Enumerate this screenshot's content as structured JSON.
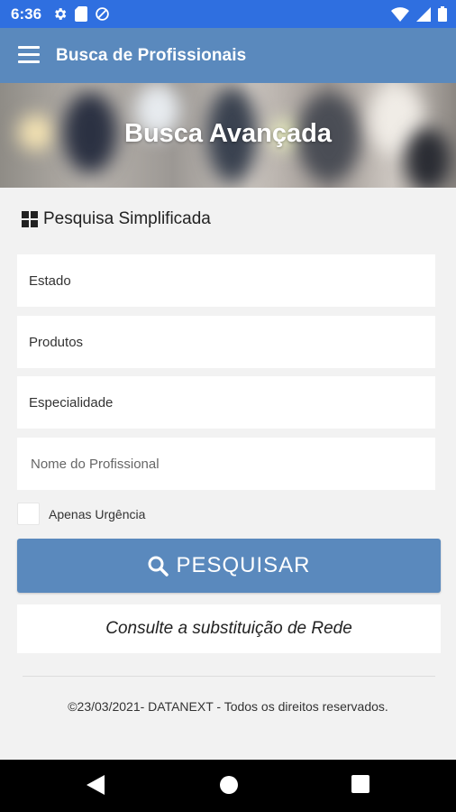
{
  "status_bar": {
    "time": "6:36",
    "left_icons": [
      "gear-icon",
      "sd-card-icon",
      "data-saver-icon"
    ],
    "right_icons": [
      "wifi-icon",
      "signal-icon",
      "battery-icon"
    ]
  },
  "app_bar": {
    "title": "Busca de Profissionais",
    "menu_icon": "menu-icon"
  },
  "hero": {
    "title": "Busca Avançada"
  },
  "section": {
    "title": "Pesquisa Simplificada",
    "icon": "grid-icon"
  },
  "form": {
    "estado": {
      "value": "Estado"
    },
    "produtos": {
      "value": "Produtos"
    },
    "especialidade": {
      "value": "Especialidade"
    },
    "nome": {
      "placeholder": "Nome do Profissional"
    },
    "urgencia": {
      "label": "Apenas Urgência",
      "checked": false
    }
  },
  "actions": {
    "search_label": "PESQUISAR",
    "search_icon": "search-icon",
    "rede_label": "Consulte a substituição de Rede"
  },
  "footer": {
    "text": "©23/03/2021- DATANEXT - Todos os direitos reservados."
  },
  "nav_bar": {
    "icons": [
      "back-icon",
      "home-icon",
      "recents-icon"
    ]
  },
  "colors": {
    "status_bar": "#2f6fe0",
    "app_bar": "#5a89bd",
    "primary_button": "#5a89bd",
    "background": "#f2f2f2"
  }
}
